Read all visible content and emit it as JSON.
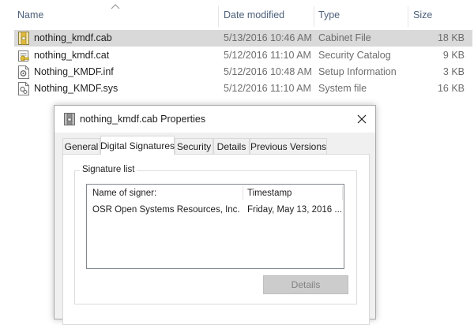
{
  "columns": {
    "name": "Name",
    "date_modified": "Date modified",
    "type": "Type",
    "size": "Size"
  },
  "files": [
    {
      "name": "nothing_kmdf.cab",
      "date": "5/13/2016 10:46 AM",
      "type": "Cabinet File",
      "size": "18 KB",
      "icon": "cabinet-file-icon",
      "selected": true
    },
    {
      "name": "nothing_kmdf.cat",
      "date": "5/12/2016 11:10 AM",
      "type": "Security Catalog",
      "size": "9 KB",
      "icon": "security-catalog-icon",
      "selected": false
    },
    {
      "name": "Nothing_KMDF.inf",
      "date": "5/12/2016 10:48 AM",
      "type": "Setup Information",
      "size": "3 KB",
      "icon": "setup-information-icon",
      "selected": false
    },
    {
      "name": "Nothing_KMDF.sys",
      "date": "5/12/2016 11:10 AM",
      "type": "System file",
      "size": "16 KB",
      "icon": "system-file-icon",
      "selected": false
    }
  ],
  "dialog": {
    "title": "nothing_kmdf.cab Properties",
    "tabs": {
      "general": "General",
      "digital_signatures": "Digital Signatures",
      "security": "Security",
      "details": "Details",
      "previous_versions": "Previous Versions"
    },
    "active_tab": "Digital Signatures",
    "signature_group_label": "Signature list",
    "list_headers": {
      "signer": "Name of signer:",
      "timestamp": "Timestamp"
    },
    "signatures": [
      {
        "signer": "OSR Open Systems Resources, Inc.",
        "timestamp": "Friday, May 13, 2016 ..."
      }
    ],
    "details_button": "Details"
  },
  "colors": {
    "selected_row": "#d9d9d9",
    "header_text": "#4c607a",
    "dialog_bg": "#f0f0f0"
  }
}
